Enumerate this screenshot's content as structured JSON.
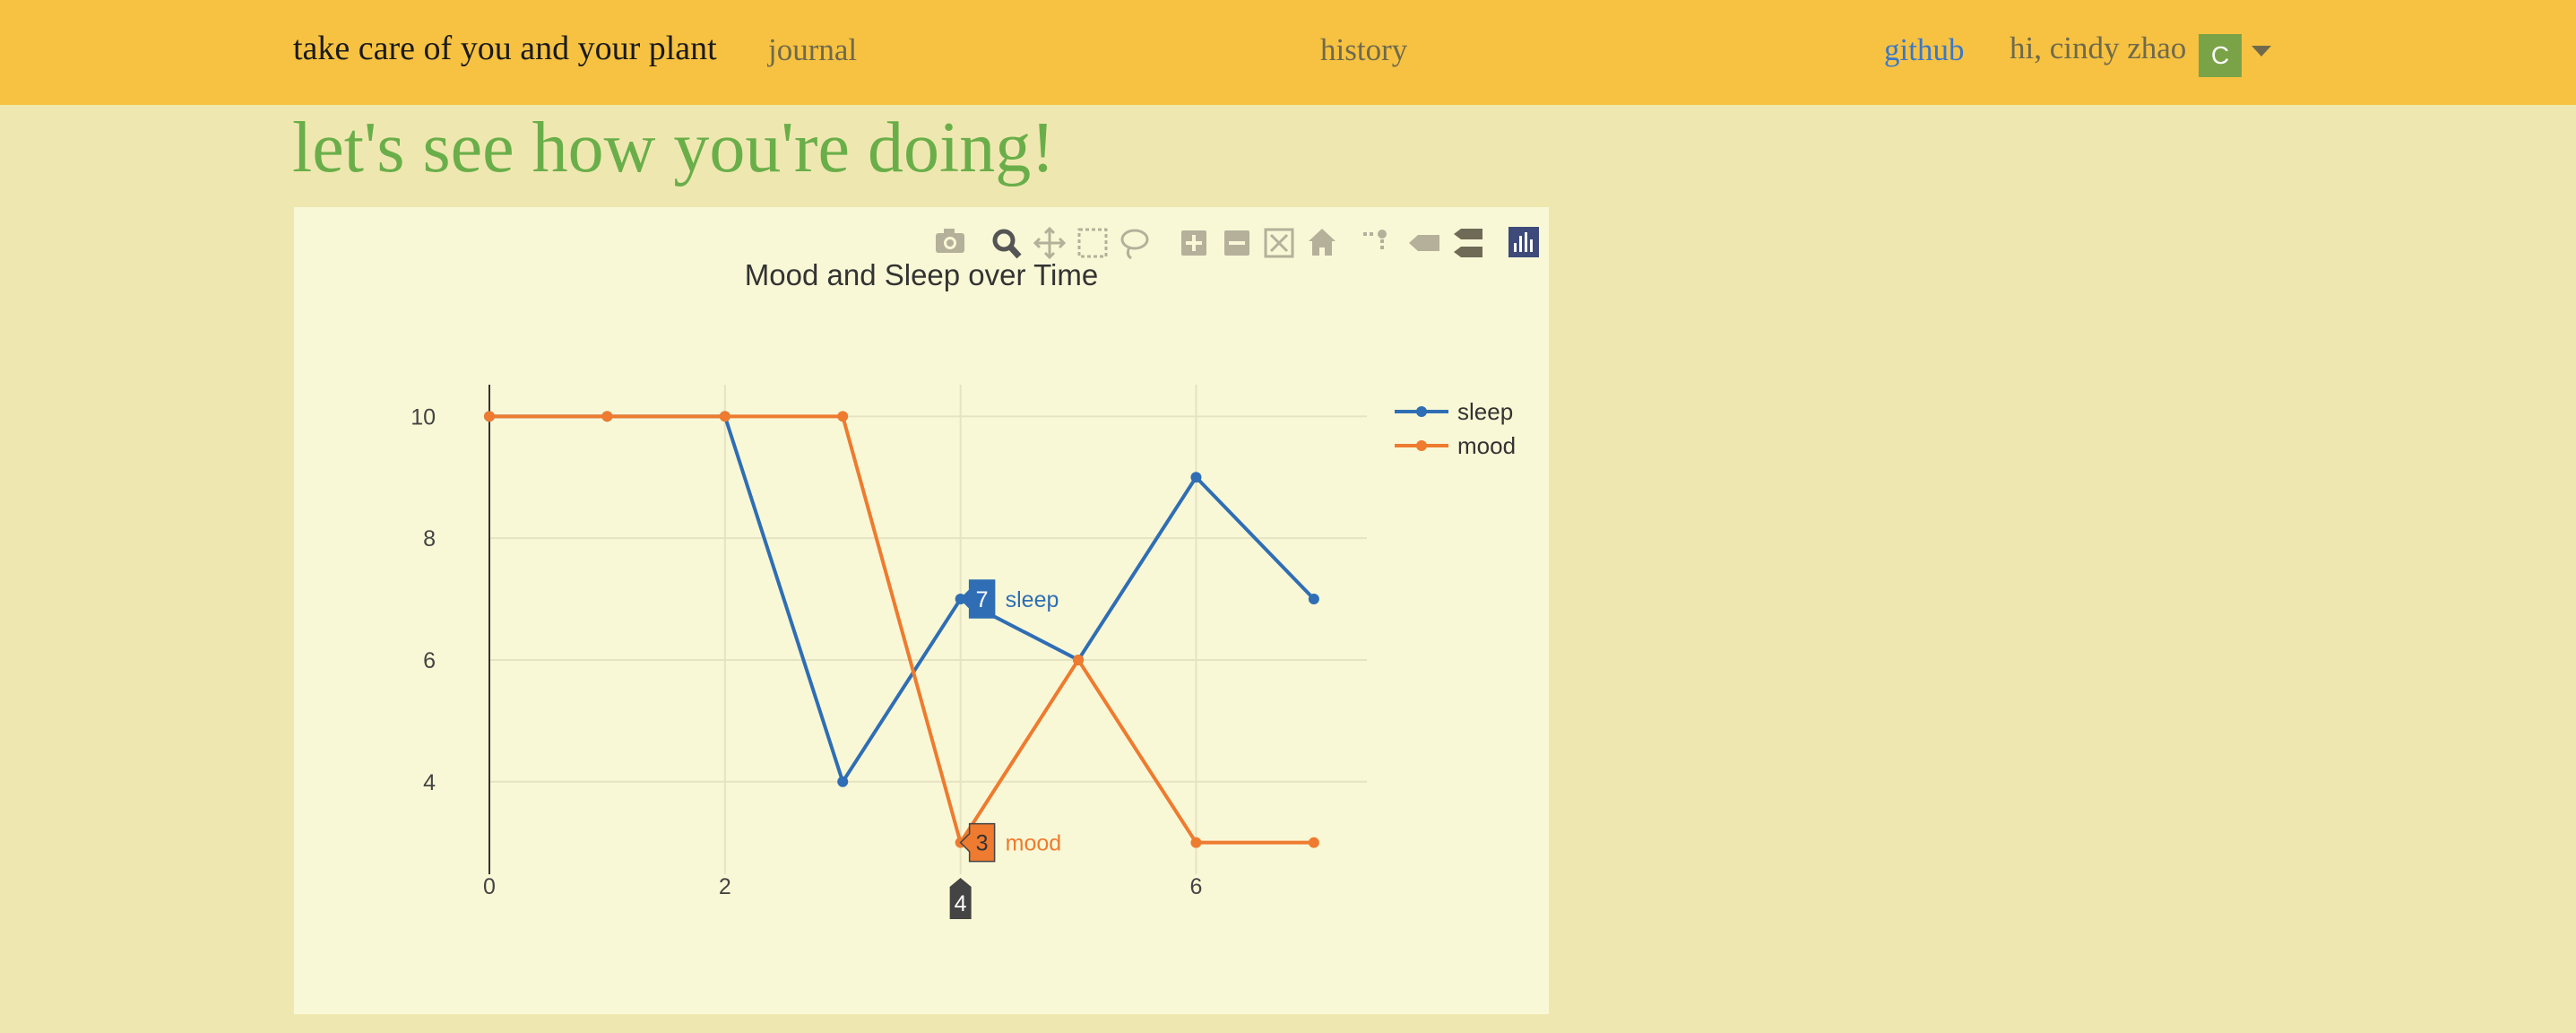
{
  "navbar": {
    "brand": "take care of you and your plant",
    "journal_link": "journal",
    "history_link": "history",
    "github_link": "github",
    "greeting": "hi, cindy zhao",
    "avatar_initial": "C",
    "accent_color": "#f7c242"
  },
  "page": {
    "heading": "let's see how you're doing!",
    "background_color": "#eee8b0",
    "heading_color": "#6aae4a"
  },
  "modebar": {
    "buttons": [
      "camera-icon",
      "zoom-icon",
      "pan-icon",
      "box-select-icon",
      "lasso-select-icon",
      "zoom-in-icon",
      "zoom-out-icon",
      "autoscale-icon",
      "reset-axes-icon",
      "spike-lines-icon",
      "hover-closest-icon",
      "hover-compare-icon",
      "plotly-logo-icon"
    ]
  },
  "chart_data": {
    "type": "line",
    "title": "Mood and Sleep over Time",
    "xlabel": "",
    "ylabel": "",
    "x": [
      0,
      1,
      2,
      3,
      4,
      5,
      6,
      7
    ],
    "x_ticks": [
      0,
      2,
      4,
      6
    ],
    "y_ticks": [
      4,
      6,
      8,
      10
    ],
    "xlim": [
      0,
      7.45
    ],
    "ylim": [
      2.48,
      10.52
    ],
    "grid": true,
    "legend_position": "top-right",
    "series": [
      {
        "name": "sleep",
        "color": "#2f6eb4",
        "values": [
          10,
          10,
          10,
          4,
          7,
          6,
          9,
          7
        ]
      },
      {
        "name": "mood",
        "color": "#ee7b2f",
        "values": [
          10,
          10,
          10,
          10,
          3,
          6,
          3,
          3
        ]
      }
    ],
    "hover": {
      "x": 4,
      "x_label": "4",
      "labels": [
        {
          "series": "sleep",
          "value": "7",
          "name": "sleep"
        },
        {
          "series": "mood",
          "value": "3",
          "name": "mood"
        }
      ]
    }
  }
}
